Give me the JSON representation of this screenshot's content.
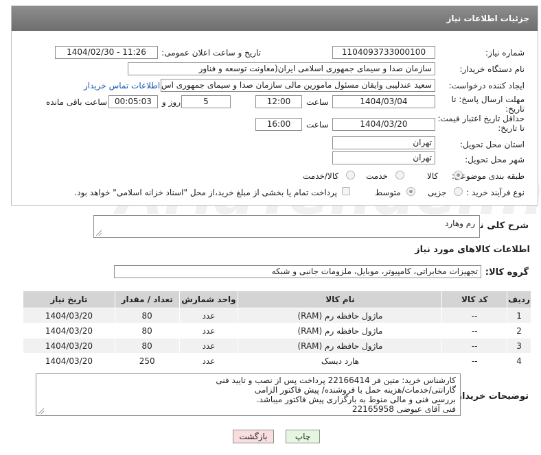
{
  "header": {
    "title": "جزئیات اطلاعات نیاز"
  },
  "fields": {
    "need_number": {
      "label": "شماره نیاز:",
      "value": "1104093733000100"
    },
    "announce_datetime": {
      "label": "تاریخ و ساعت اعلان عمومی:",
      "value": "1404/02/30 - 11:26"
    },
    "buyer_org": {
      "label": "نام دستگاه خریدار:",
      "value": "سازمان صدا و سیمای جمهوری اسلامی ایران(معاونت توسعه و فناور"
    },
    "requester": {
      "label": "ایجاد کننده درخواست:",
      "value": "سعید عندلیبی وایقان مسئول مامورین مالی  سازمان صدا و سیمای جمهوری اس",
      "contact_link": "اطلاعات تماس خریدار"
    },
    "reply_deadline": {
      "label_line1": "مهلت ارسال پاسخ: تا",
      "label_line2": "تاریخ:",
      "date": "1404/03/04",
      "time_label": "ساعت",
      "time": "12:00",
      "days": "5",
      "days_label": "روز و",
      "remaining": "00:05:03",
      "remaining_label": "ساعت باقی مانده"
    },
    "price_validity": {
      "label_line1": "حداقل تاریخ اعتبار قیمت:",
      "label_line2": "تا تاریخ:",
      "date": "1404/03/20",
      "time_label": "ساعت",
      "time": "16:00"
    },
    "delivery_province": {
      "label": "استان محل تحویل:",
      "value": "تهران"
    },
    "delivery_city": {
      "label": "شهر محل تحویل:",
      "value": "تهران"
    },
    "category": {
      "label": "طبقه بندی موضوعی:",
      "options": [
        "کالا",
        "خدمت",
        "کالا/خدمت"
      ],
      "selected": "کالا"
    },
    "purchase_type": {
      "label": "نوع فرآیند خرید :",
      "options": [
        "جزیی",
        "متوسط"
      ],
      "selected": "متوسط",
      "payment_note": "پرداخت تمام یا بخشی از مبلغ خرید،از محل \"اسناد خزانه اسلامی\" خواهد بود."
    }
  },
  "summary": {
    "label": "شرح کلی نیاز:",
    "value": "رم وهارد"
  },
  "goods_section": {
    "title": "اطلاعات کالاهای مورد نیاز"
  },
  "goods_group": {
    "label": "گروه کالا:",
    "value": "تجهیزات مخابراتی، کامپیوتر، موبایل، ملزومات جانبی و شبکه"
  },
  "table": {
    "headers": [
      "ردیف",
      "کد کالا",
      "نام کالا",
      "واحد شمارش",
      "تعداد / مقدار",
      "تاریخ نیاز"
    ],
    "rows": [
      [
        "1",
        "--",
        "ماژول حافظه رم (RAM)",
        "عدد",
        "80",
        "1404/03/20"
      ],
      [
        "2",
        "--",
        "ماژول حافظه رم (RAM)",
        "عدد",
        "80",
        "1404/03/20"
      ],
      [
        "3",
        "--",
        "ماژول حافظه رم (RAM)",
        "عدد",
        "80",
        "1404/03/20"
      ],
      [
        "4",
        "--",
        "هارد دیسک",
        "عدد",
        "250",
        "1404/03/20"
      ]
    ]
  },
  "buyer_notes": {
    "label": "توضیحات خریدار:",
    "lines": [
      "کارشناس خرید: متین فر 22166414   پرداخت پس از نصب و تایید فنی",
      "گارانتی/خدمات/هزینه حمل با فروشنده/ پیش فاکتور الزامی",
      "بررسی فنی و مالی منوط به بارگزاری پیش فاکتور میباشد.",
      "فنی آقای عیوضی 22165958"
    ]
  },
  "buttons": {
    "print": "چاپ",
    "back": "بازگشت"
  },
  "watermark": "AriaTender.neT",
  "colors": {
    "header_bg": "#7a7a7a",
    "link": "#1a56b0",
    "back_button_bg": "#f8dede",
    "print_button_bg": "#e6f5df"
  }
}
